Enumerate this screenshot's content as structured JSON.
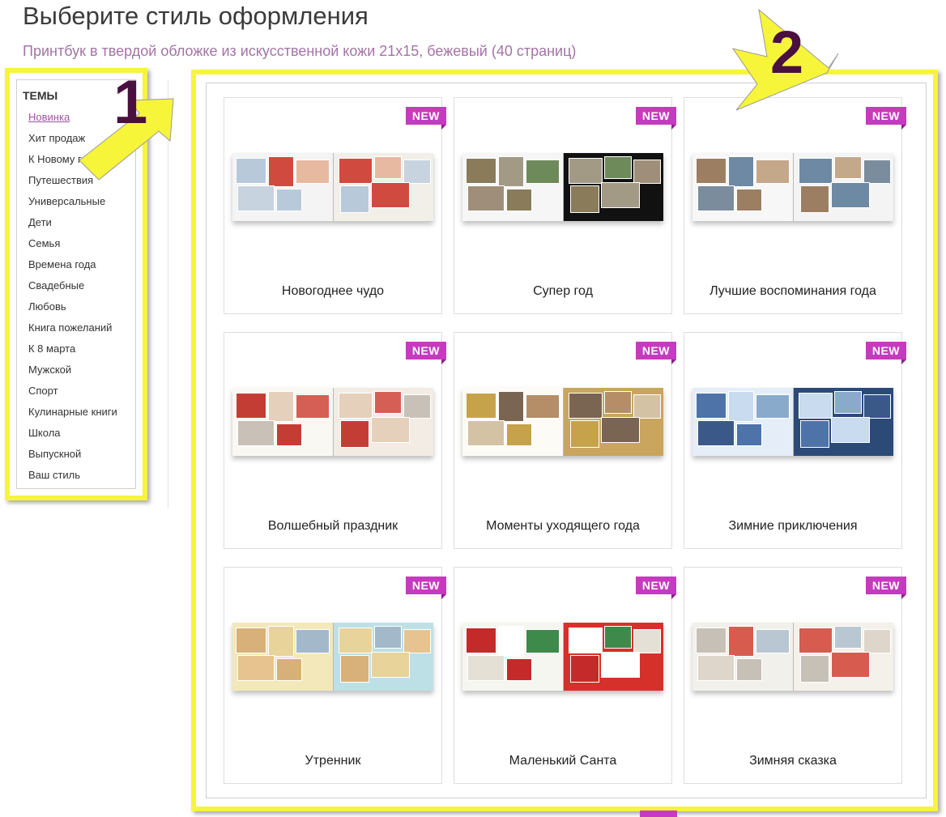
{
  "page": {
    "title": "Выберите стиль оформления",
    "subtitle": "Принтбук в твердой обложке из искусственной кожи 21х15, бежевый (40 страниц)"
  },
  "sidebar": {
    "heading": "ТЕМЫ",
    "items": [
      {
        "label": "Новинка",
        "active": true
      },
      {
        "label": "Хит продаж"
      },
      {
        "label": "К Новому году"
      },
      {
        "label": "Путешествия"
      },
      {
        "label": "Универсальные"
      },
      {
        "label": "Дети"
      },
      {
        "label": "Семья"
      },
      {
        "label": "Времена года"
      },
      {
        "label": "Свадебные"
      },
      {
        "label": "Любовь"
      },
      {
        "label": "Книга пожеланий"
      },
      {
        "label": "К 8 марта"
      },
      {
        "label": "Мужской"
      },
      {
        "label": "Спорт"
      },
      {
        "label": "Кулинарные книги"
      },
      {
        "label": "Школа"
      },
      {
        "label": "Выпускной"
      },
      {
        "label": "Ваш стиль"
      }
    ]
  },
  "annotations": {
    "callout_1": "1",
    "callout_2": "2",
    "arrow_color": "#f7f53a",
    "number_color": "#4a1040"
  },
  "colors": {
    "badge": "#c53bbf",
    "highlight": "#f7f53a",
    "link_active": "#a053a5",
    "subtitle": "#a374a6"
  },
  "grid": {
    "badge_label": "NEW",
    "cards": [
      {
        "title": "Новогоднее чудо",
        "left_bg": "#f4f4f4",
        "right_bg": "#f2efe9",
        "tones": [
          "#b8c9da",
          "#d14a3f",
          "#e7b9a0",
          "#c7d3df"
        ]
      },
      {
        "title": "Супер год",
        "left_bg": "#f6f6f6",
        "right_bg": "#111111",
        "tones": [
          "#8a7b5a",
          "#a39a86",
          "#6f8a5a",
          "#9f8f7a"
        ]
      },
      {
        "title": "Лучшие воспоминания года",
        "left_bg": "#f7f7f7",
        "right_bg": "#f4f4f4",
        "tones": [
          "#9c7f62",
          "#6d89a3",
          "#c4a88a",
          "#7b8d9c"
        ]
      },
      {
        "title": "Волшебный праздник",
        "left_bg": "#faf8f3",
        "right_bg": "#f3ece5",
        "tones": [
          "#c43d35",
          "#e5d0bb",
          "#d65f55",
          "#c9c1b8"
        ]
      },
      {
        "title": "Моменты уходящего года",
        "left_bg": "#fdfbf6",
        "right_bg": "#c9a55e",
        "tones": [
          "#c6a34b",
          "#7a6552",
          "#b58e67",
          "#d4c2a5"
        ]
      },
      {
        "title": "Зимние приключения",
        "left_bg": "#e5eef8",
        "right_bg": "#2b4a78",
        "tones": [
          "#4d73a8",
          "#c8dbef",
          "#8aaacb",
          "#3a5888"
        ]
      },
      {
        "title": "Утренник",
        "left_bg": "#f3e8b9",
        "right_bg": "#bde0e6",
        "tones": [
          "#d7b07a",
          "#e8d39a",
          "#a3b9c9",
          "#e6c38f"
        ]
      },
      {
        "title": "Маленький Санта",
        "left_bg": "#f6f6f1",
        "right_bg": "#d6302b",
        "tones": [
          "#c52a2a",
          "#ffffff",
          "#3d8a4a",
          "#e4e0d6"
        ]
      },
      {
        "title": "Зимняя сказка",
        "left_bg": "#f1f0ea",
        "right_bg": "#f3f1ea",
        "tones": [
          "#c7c0b6",
          "#d85b50",
          "#b8c7d2",
          "#ded6ca"
        ]
      }
    ]
  }
}
